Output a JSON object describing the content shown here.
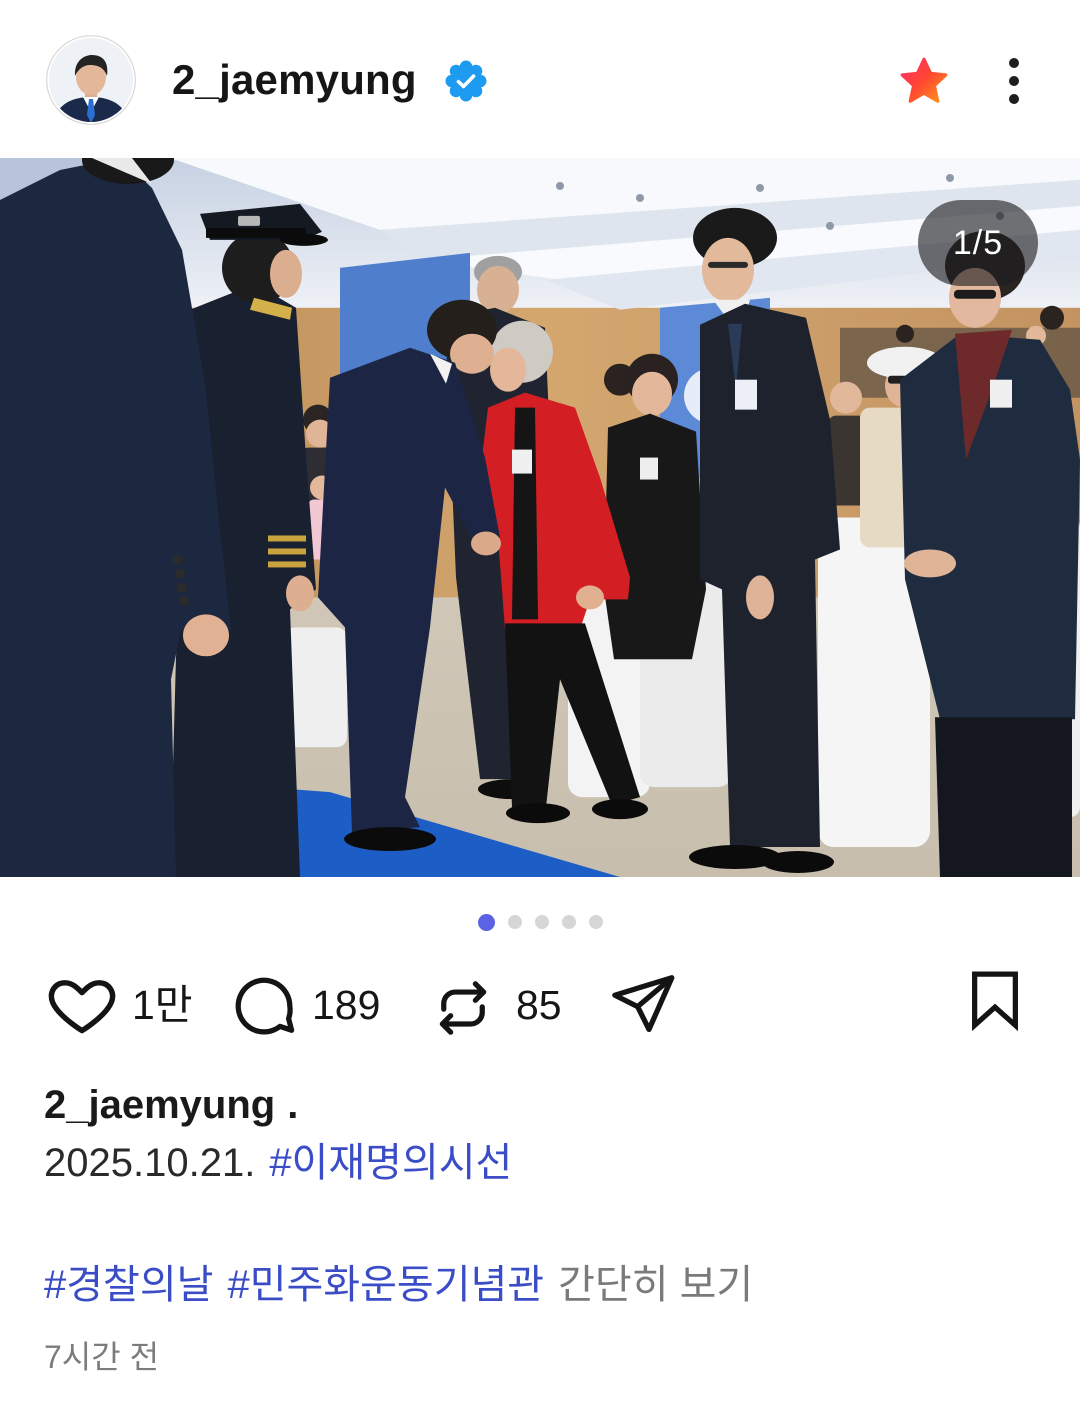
{
  "header": {
    "username": "2_jaemyung",
    "avatar_icon": "profile-avatar",
    "verified_icon": "verified-badge-icon",
    "favorite_icon": "star-icon",
    "more_icon": "more-vertical-icon"
  },
  "media": {
    "counter": "1/5"
  },
  "pagination": {
    "count": 5,
    "active_index": 0
  },
  "actions": {
    "like_icon": "heart-icon",
    "like_count": "1만",
    "comment_icon": "comment-icon",
    "comment_count": "189",
    "repost_icon": "repost-icon",
    "repost_count": "85",
    "share_icon": "send-icon",
    "save_icon": "bookmark-icon"
  },
  "caption": {
    "username": "2_jaemyung",
    "separator": ".",
    "date": "2025.10.21.",
    "hashtags_line1": [
      "#이재명의시선"
    ],
    "hashtags_line2": [
      "#경찰의날",
      "#민주화운동기념관"
    ],
    "more_label": "간단히 보기"
  },
  "timestamp": "7시간 전",
  "colors": {
    "text": "#1c1c1c",
    "link": "#3a4cc6",
    "muted": "#7a7a7a",
    "verified": "#1d9bf0",
    "dot_active": "#5a63e6",
    "dot_inactive": "#d6d6d6",
    "star_start": "#ff2f6a",
    "star_end": "#ff9b1a"
  }
}
